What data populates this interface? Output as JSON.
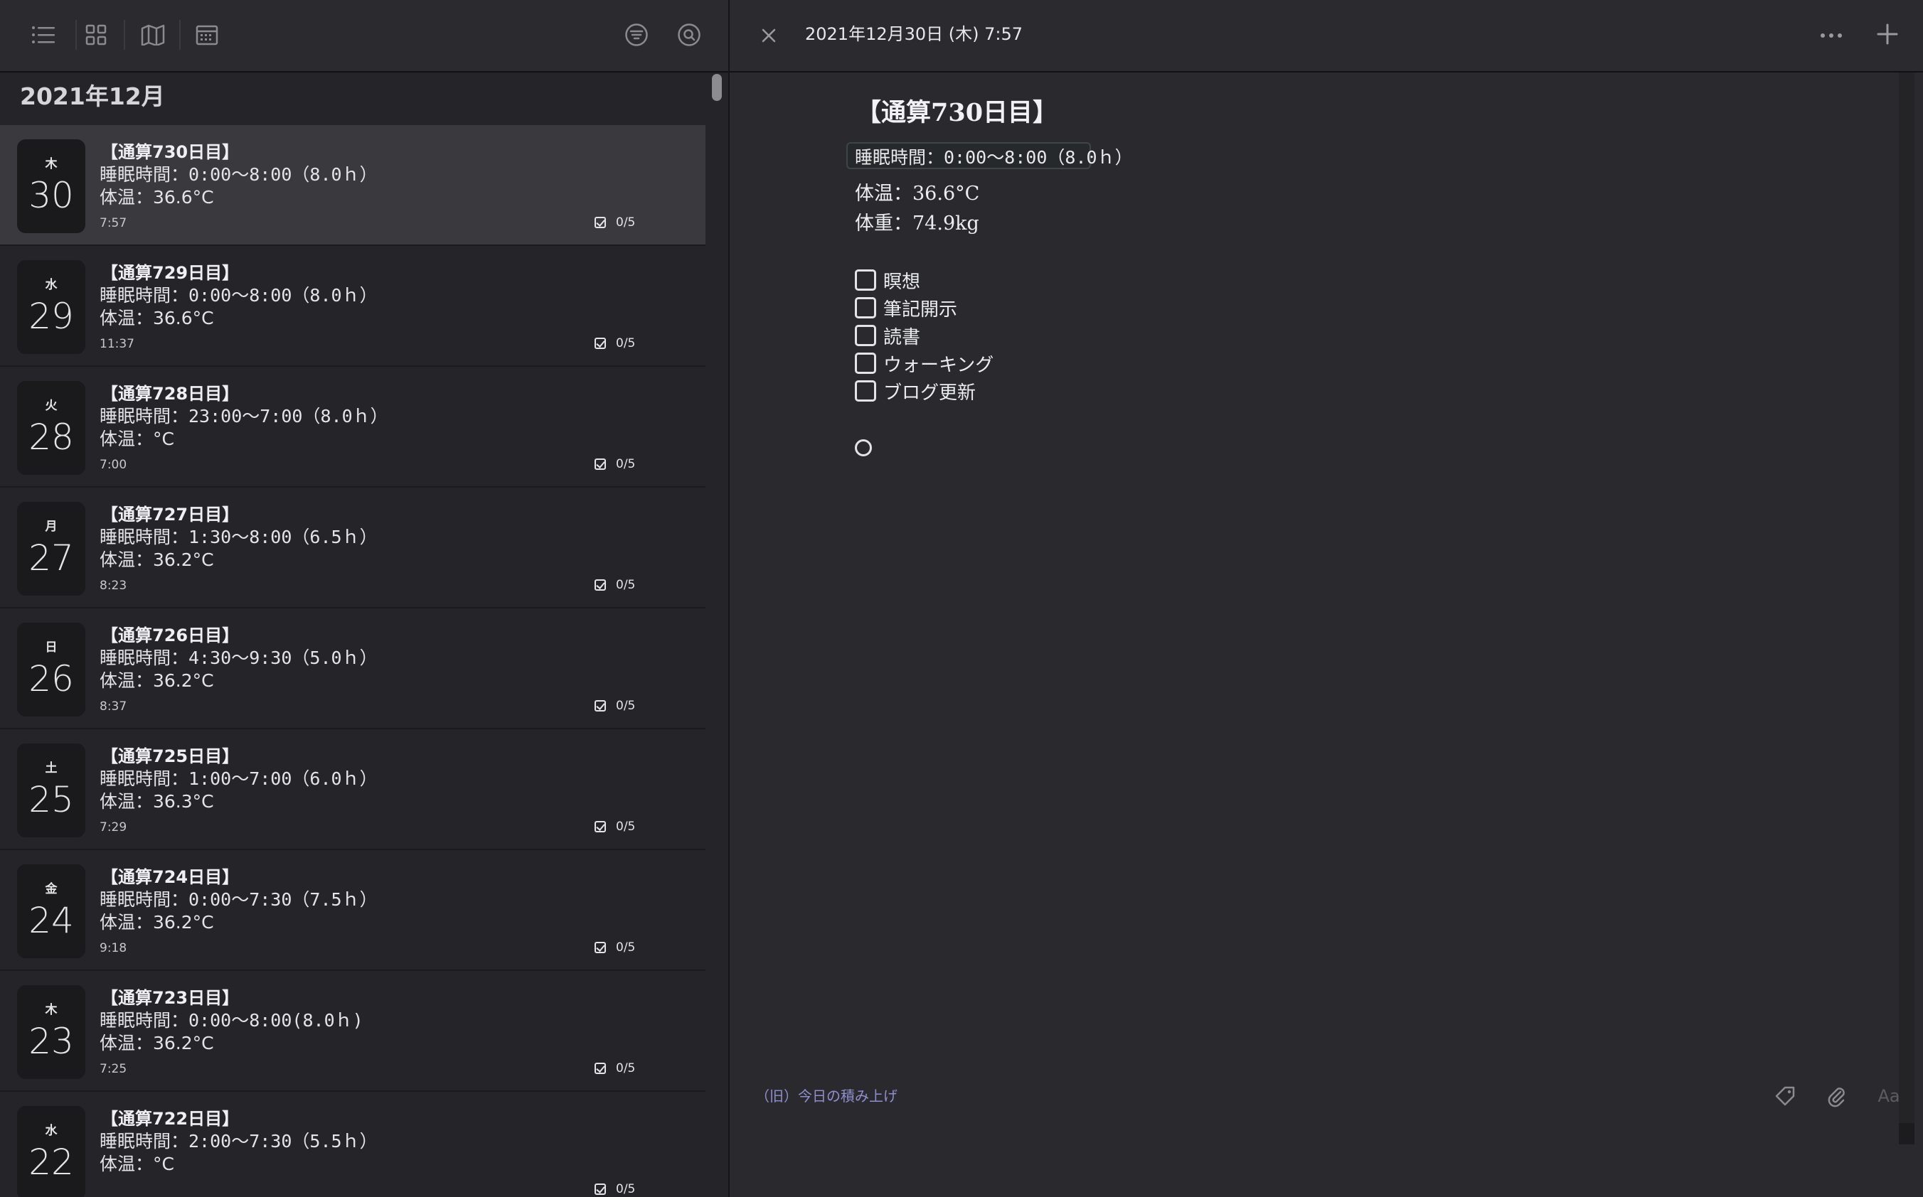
{
  "month_header": "2021年12月",
  "entries": [
    {
      "weekday": "木",
      "day": "30",
      "title": "【通算730日目】",
      "sleep": "睡眠時間：0:00〜8:00（8.0ｈ）",
      "temp": "体温：36.6°C",
      "time": "7:57",
      "progress": "0/5",
      "selected": true
    },
    {
      "weekday": "水",
      "day": "29",
      "title": "【通算729日目】",
      "sleep": "睡眠時間：0:00〜8:00（8.0ｈ）",
      "temp": "体温：36.6°C",
      "time": "11:37",
      "progress": "0/5"
    },
    {
      "weekday": "火",
      "day": "28",
      "title": "【通算728日目】",
      "sleep": "睡眠時間：23:00〜7:00（8.0ｈ）",
      "temp": "体温：°C",
      "time": "7:00",
      "progress": "0/5"
    },
    {
      "weekday": "月",
      "day": "27",
      "title": "【通算727日目】",
      "sleep": "睡眠時間：1:30〜8:00（6.5ｈ）",
      "temp": "体温：36.2°C",
      "time": "8:23",
      "progress": "0/5"
    },
    {
      "weekday": "日",
      "day": "26",
      "title": "【通算726日目】",
      "sleep": "睡眠時間：4:30〜9:30（5.0ｈ）",
      "temp": "体温：36.2°C",
      "time": "8:37",
      "progress": "0/5"
    },
    {
      "weekday": "土",
      "day": "25",
      "title": "【通算725日目】",
      "sleep": "睡眠時間：1:00〜7:00（6.0ｈ）",
      "temp": "体温：36.3°C",
      "time": "7:29",
      "progress": "0/5"
    },
    {
      "weekday": "金",
      "day": "24",
      "title": "【通算724日目】",
      "sleep": "睡眠時間：0:00〜7:30（7.5ｈ）",
      "temp": "体温：36.2°C",
      "time": "9:18",
      "progress": "0/5"
    },
    {
      "weekday": "木",
      "day": "23",
      "title": "【通算723日目】",
      "sleep": "睡眠時間：0:00〜8:00(8.0ｈ)",
      "temp": "体温：36.2°C",
      "time": "7:25",
      "progress": "0/5"
    },
    {
      "weekday": "水",
      "day": "22",
      "title": "【通算722日目】",
      "sleep": "睡眠時間：2:00〜7:30（5.5ｈ）",
      "temp": "体温：°C",
      "time": "",
      "progress": "0/5"
    }
  ],
  "detail": {
    "header_date": "2021年12月30日 (木) 7:57",
    "title": "【通算730日目】",
    "sleep": "睡眠時間：0:00〜8:00（8.0ｈ）",
    "temp": "体温：36.6°C",
    "weight": "体重：74.9kg",
    "todos": [
      "瞑想",
      "筆記開示",
      "読書",
      "ウォーキング",
      "ブログ更新"
    ],
    "footer_link": "（旧）今日の積み上げ",
    "aa_label": "Aa"
  },
  "icons": {
    "list": "list-view-icon",
    "grid": "grid-view-icon",
    "map": "map-view-icon",
    "calendar": "calendar-view-icon",
    "filter": "filter-icon",
    "search": "search-icon",
    "close": "close-icon",
    "more": "more-icon",
    "plus": "plus-icon",
    "tag": "tag-icon",
    "attach": "paperclip-icon"
  }
}
